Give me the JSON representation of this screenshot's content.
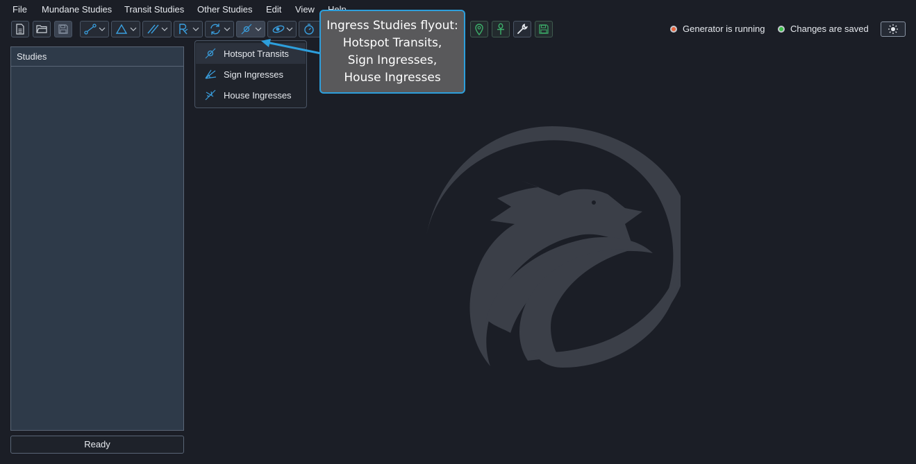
{
  "menu": {
    "file": "File",
    "mundane": "Mundane Studies",
    "transit": "Transit Studies",
    "other": "Other Studies",
    "edit": "Edit",
    "view": "View",
    "help": "Help"
  },
  "toolbar_icons": [
    "new-file-icon",
    "open-folder-icon",
    "save-icon",
    "aspect-link-icon",
    "triangle-icon",
    "parallel-icon",
    "rx-icon",
    "cycle-icon",
    "ingress-icon",
    "eclipse-icon",
    "timer-icon",
    "location-pin-icon",
    "ankh-icon",
    "wrench-icon",
    "disk-icon"
  ],
  "status": {
    "generator": "Generator is running",
    "saved": "Changes are saved",
    "generator_color": "#e8643c",
    "saved_color": "#3cc24a"
  },
  "panel": {
    "title": "Studies"
  },
  "statusbar": {
    "text": "Ready"
  },
  "flyout": {
    "items": [
      {
        "label": "Hotspot Transits",
        "icon": "hotspot-icon"
      },
      {
        "label": "Sign Ingresses",
        "icon": "sign-ingress-icon"
      },
      {
        "label": "House Ingresses",
        "icon": "house-ingress-icon"
      }
    ]
  },
  "callout": {
    "lines": [
      "Ingress Studies flyout:",
      "Hotspot Transits,",
      "Sign Ingresses,",
      "House Ingresses"
    ],
    "border_color": "#2d9fdc"
  },
  "colors": {
    "background": "#1b1e26",
    "accent": "#2d9fdc",
    "panel": "#2e3a49"
  }
}
